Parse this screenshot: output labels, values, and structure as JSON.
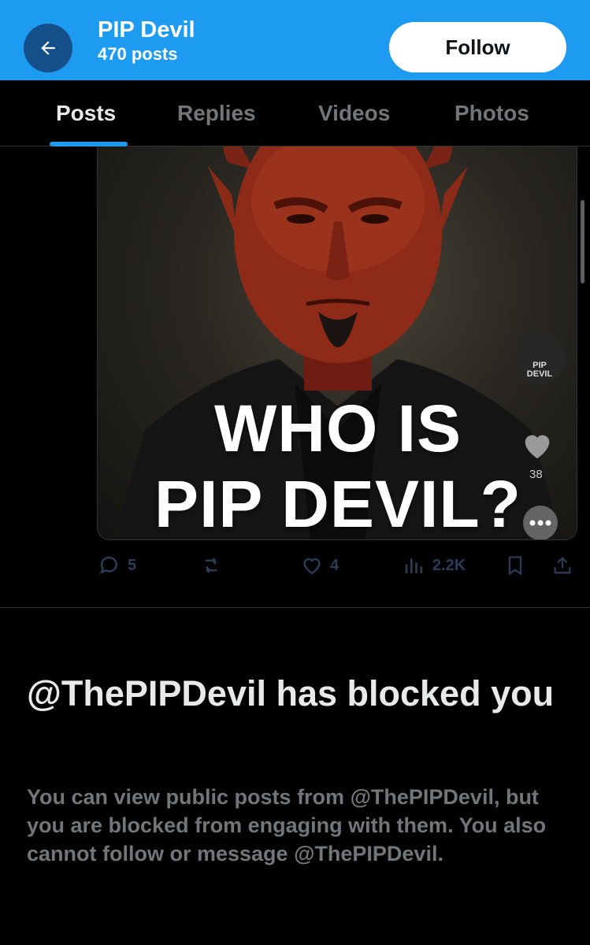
{
  "header": {
    "title": "PIP Devil",
    "post_count": "470 posts",
    "follow_label": "Follow",
    "back_icon": "arrow-left-icon",
    "background": "#1d9bf0"
  },
  "tabs": [
    {
      "label": "Posts",
      "active": true
    },
    {
      "label": "Replies",
      "active": false
    },
    {
      "label": "Videos",
      "active": false
    },
    {
      "label": "Photos",
      "active": false
    }
  ],
  "post": {
    "media": {
      "overlay_line1": "WHO IS",
      "overlay_line2": "PIP DEVIL?",
      "watermark_line1": "PIP",
      "watermark_line2": "DEVIL",
      "overlay_likes": "38"
    },
    "actions": {
      "replies": "5",
      "reposts": "",
      "likes": "4",
      "views": "2.2K"
    }
  },
  "blocked": {
    "title": "@ThePIPDevil has blocked you",
    "description": "You can view public posts from @ThePIPDevil, but you are blocked from engaging with them. You also cannot follow or message @ThePIPDevil."
  },
  "colors": {
    "accent": "#1d9bf0",
    "muted_text": "#71767b",
    "action_icons": "#2b3a55"
  }
}
